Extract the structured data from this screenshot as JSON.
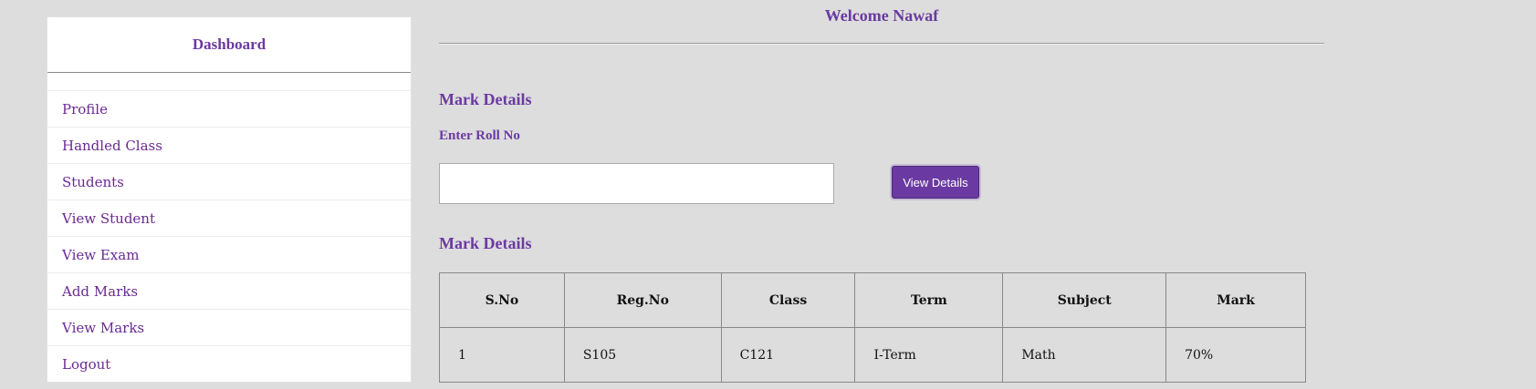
{
  "sidebar": {
    "title": "Dashboard",
    "items": [
      {
        "label": "Profile"
      },
      {
        "label": "Handled Class"
      },
      {
        "label": "Students"
      },
      {
        "label": "View Student"
      },
      {
        "label": "View Exam"
      },
      {
        "label": "Add Marks"
      },
      {
        "label": "View Marks"
      },
      {
        "label": "Logout"
      }
    ]
  },
  "header": {
    "welcome": "Welcome Nawaf"
  },
  "search": {
    "title": "Mark Details",
    "label": "Enter Roll No",
    "value": "",
    "placeholder": "",
    "button_label": "View Details"
  },
  "results": {
    "title": "Mark Details",
    "columns": [
      "S.No",
      "Reg.No",
      "Class",
      "Term",
      "Subject",
      "Mark"
    ],
    "rows": [
      [
        "1",
        "S105",
        "C121",
        "I-Term",
        "Math",
        "70%"
      ]
    ]
  },
  "colors": {
    "accent": "#6a3aa2",
    "background": "#dddddd"
  }
}
